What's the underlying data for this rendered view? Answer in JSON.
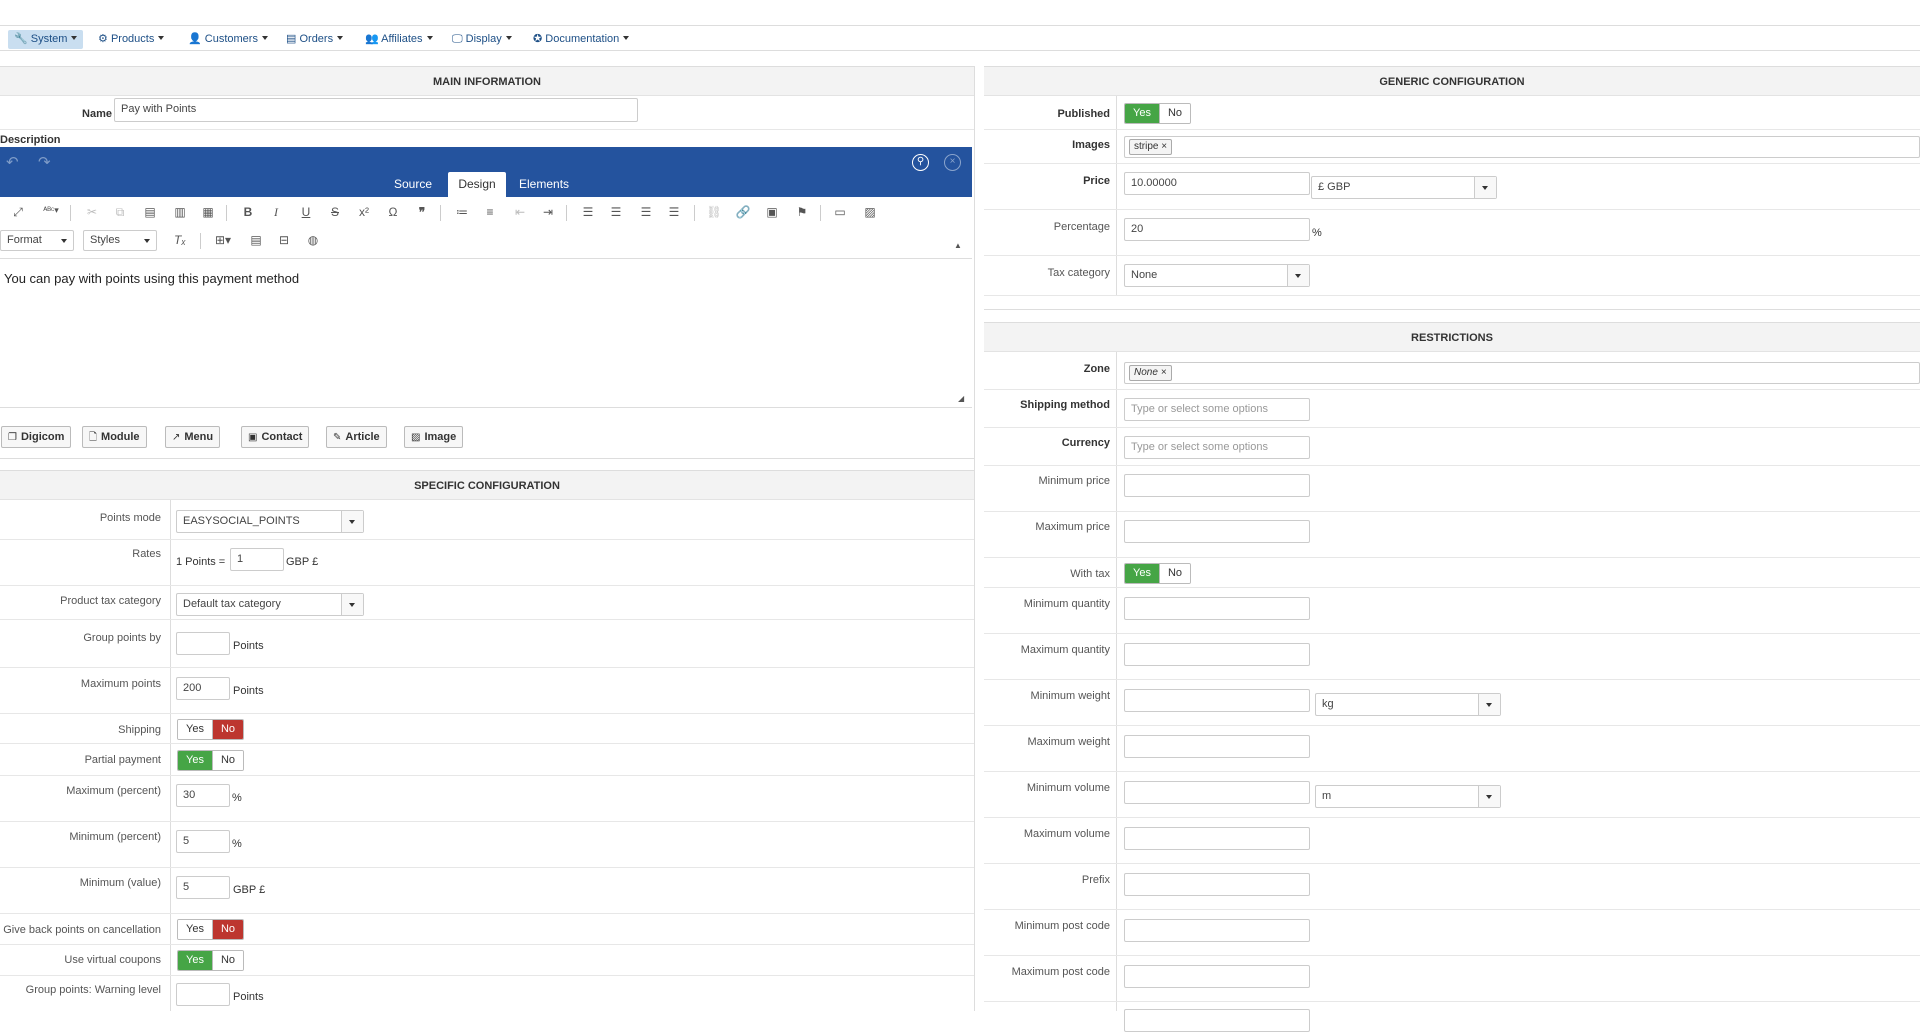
{
  "menu": [
    {
      "label": "System",
      "icon": "wrench-icon",
      "glyph": "🔧"
    },
    {
      "label": "Products",
      "icon": "products-icon",
      "glyph": "⚙"
    },
    {
      "label": "Customers",
      "icon": "user-icon",
      "glyph": "👤"
    },
    {
      "label": "Orders",
      "icon": "orders-icon",
      "glyph": "▤"
    },
    {
      "label": "Affiliates",
      "icon": "users-icon",
      "glyph": "👥"
    },
    {
      "label": "Display",
      "icon": "monitor-icon",
      "glyph": "🖵"
    },
    {
      "label": "Documentation",
      "icon": "lifebuoy-icon",
      "glyph": "✪"
    }
  ],
  "main_info": {
    "title": "MAIN INFORMATION",
    "name_label": "Name",
    "name_value": "Pay with Points",
    "description_label": "Description"
  },
  "editor": {
    "tabs": [
      "Source",
      "Design",
      "Elements"
    ],
    "active_tab": "Design",
    "format_label": "Format",
    "styles_label": "Styles",
    "content": "You can pay with points using this payment method",
    "toolbar_color": "#24539e"
  },
  "insert_buttons": [
    {
      "label": "Digicom",
      "icon": "digicom-icon",
      "glyph": "❐"
    },
    {
      "label": "Module",
      "icon": "file-icon",
      "glyph": "🗋"
    },
    {
      "label": "Menu",
      "icon": "share-icon",
      "glyph": "↗"
    },
    {
      "label": "Contact",
      "icon": "contact-icon",
      "glyph": "▣"
    },
    {
      "label": "Article",
      "icon": "edit-icon",
      "glyph": "✎"
    },
    {
      "label": "Image",
      "icon": "image-icon",
      "glyph": "▨"
    }
  ],
  "specific": {
    "title": "SPECIFIC CONFIGURATION",
    "points_mode_label": "Points mode",
    "points_mode_value": "EASYSOCIAL_POINTS",
    "rates_label": "Rates",
    "rates_prefix": "1 Points =",
    "rates_value": "1",
    "rates_unit": "GBP £",
    "product_tax_label": "Product tax category",
    "product_tax_value": "Default tax category",
    "group_points_label": "Group points by",
    "group_points_value": "",
    "group_points_unit": "Points",
    "max_points_label": "Maximum points",
    "max_points_value": "200",
    "max_points_unit": "Points",
    "shipping_label": "Shipping",
    "partial_label": "Partial payment",
    "max_percent_label": "Maximum (percent)",
    "max_percent_value": "30",
    "max_percent_unit": "%",
    "min_percent_label": "Minimum (percent)",
    "min_percent_value": "5",
    "min_percent_unit": "%",
    "min_value_label": "Minimum (value)",
    "min_value_value": "5",
    "min_value_unit": "GBP £",
    "give_back_label": "Give back points on cancellation",
    "virtual_coupons_label": "Use virtual coupons",
    "warning_level_label": "Group points: Warning level",
    "warning_level_value": "",
    "warning_level_unit": "Points",
    "yes": "Yes",
    "no": "No"
  },
  "generic": {
    "title": "GENERIC CONFIGURATION",
    "published_label": "Published",
    "images_label": "Images",
    "images_tag": "stripe",
    "price_label": "Price",
    "price_value": "10.00000",
    "currency_value": "£ GBP",
    "percentage_label": "Percentage",
    "percentage_value": "20",
    "percentage_unit": "%",
    "tax_label": "Tax category",
    "tax_value": "None"
  },
  "restrictions": {
    "title": "RESTRICTIONS",
    "zone_label": "Zone",
    "zone_tag": "None",
    "shipping_method_label": "Shipping method",
    "shipping_method_placeholder": "Type or select some options",
    "currency_label": "Currency",
    "currency_placeholder": "Type or select some options",
    "min_price_label": "Minimum price",
    "max_price_label": "Maximum price",
    "with_tax_label": "With tax",
    "min_qty_label": "Minimum quantity",
    "max_qty_label": "Maximum quantity",
    "min_weight_label": "Minimum weight",
    "weight_unit": "kg",
    "max_weight_label": "Maximum weight",
    "min_volume_label": "Minimum volume",
    "volume_unit": "m",
    "max_volume_label": "Maximum volume",
    "prefix_label": "Prefix",
    "min_post_label": "Minimum post code",
    "max_post_label": "Maximum post code"
  },
  "colors": {
    "yes_active": "#46a546",
    "no_active": "#bd362f",
    "menu_active": "#c9def0"
  }
}
